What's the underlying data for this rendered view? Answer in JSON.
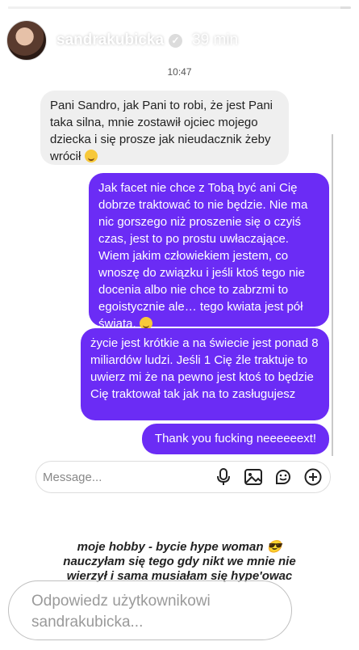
{
  "story": {
    "progress": 0.97,
    "username": "sandrakubicka",
    "verified": true,
    "time_ago": "39 min"
  },
  "dm": {
    "timestamp": "10:47",
    "messages": [
      {
        "direction": "in",
        "text": "Pani Sandro, jak Pani to robi, że jest Pani taka silna, mnie zostawił ojciec mojego dziecka i się prosze jak nieudacznik żeby wrócił",
        "emoji": "crying-face"
      },
      {
        "direction": "out",
        "text": "Jak facet nie chce z Tobą być ani Cię dobrze traktować to nie będzie. Nie ma nic gorszego niż proszenie się o czyiś czas, jest to po prostu uwłaczające. Wiem jakim człowiekiem jestem, co wnoszę do związku i jeśli ktoś tego nie docenia albo nie chce to zabrzmi to egoistycznie ale… tego kwiata jest pół świata.",
        "emoji": "smiling-face"
      },
      {
        "direction": "out",
        "text": "życie jest krótkie a na świecie jest ponad 8 miliardów ludzi. Jeśli 1 Cię źle traktuje to uwierz mi że na pewno jest ktoś to będzie Cię traktował tak jak na to zasługujesz"
      },
      {
        "direction": "out",
        "text": "Thank you fucking neeeeeext!"
      }
    ],
    "composer_placeholder": "Message..."
  },
  "caption": {
    "line1": "moje hobby - bycie hype woman 😎",
    "line2": "nauczyłam się tego gdy nikt we mnie nie",
    "line3": "wierzył i sama musiałam się hype'owac"
  },
  "reply": {
    "placeholder": "Odpowiedz użytkownikowi sandrakubicka..."
  },
  "colors": {
    "outgoing_bubble": "#6b2cf5",
    "incoming_bubble": "#efefef"
  }
}
